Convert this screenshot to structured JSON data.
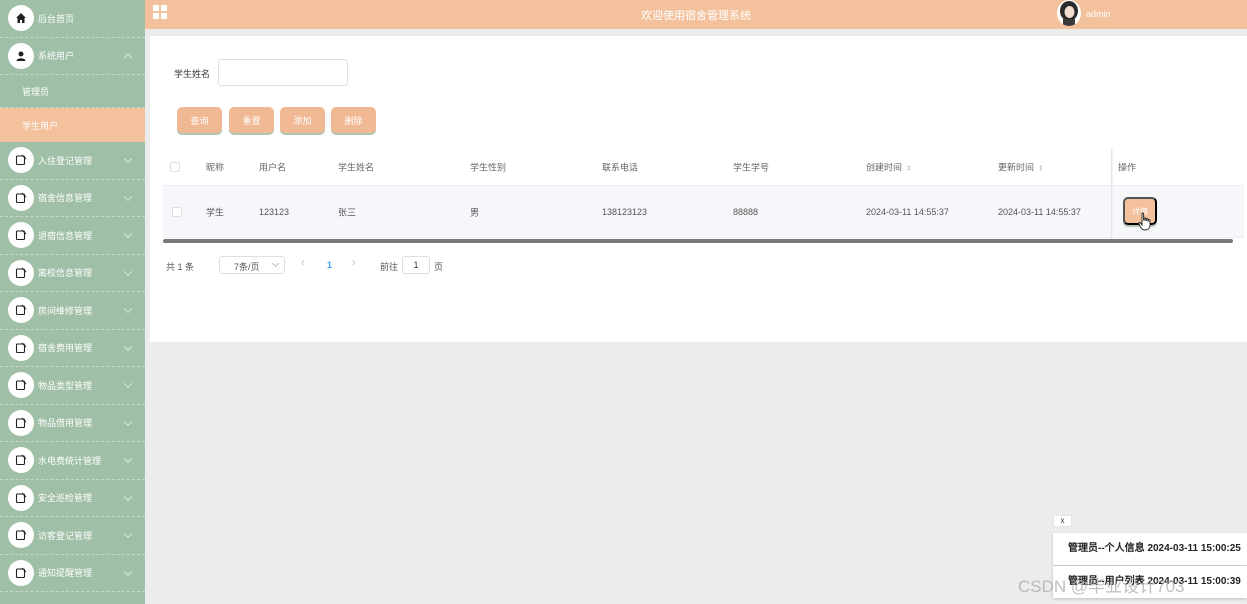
{
  "header": {
    "title": "欢迎使用宿舍管理系统",
    "user": "admin"
  },
  "sidebar": {
    "items": [
      {
        "label": "后台首页"
      },
      {
        "label": "系统用户"
      },
      {
        "label": "入住登记管理"
      },
      {
        "label": "宿舍信息管理"
      },
      {
        "label": "退宿信息管理"
      },
      {
        "label": "离校信息管理"
      },
      {
        "label": "房间维修管理"
      },
      {
        "label": "宿舍费用管理"
      },
      {
        "label": "物品类型管理"
      },
      {
        "label": "物品借用管理"
      },
      {
        "label": "水电费统计管理"
      },
      {
        "label": "安全巡检管理"
      },
      {
        "label": "访客登记管理"
      },
      {
        "label": "通知提醒管理"
      }
    ],
    "sub_items": [
      {
        "label": "管理员"
      },
      {
        "label": "学生用户"
      }
    ]
  },
  "search": {
    "label": "学生姓名",
    "value": ""
  },
  "toolbar": {
    "query": "查询",
    "reset": "重置",
    "add": "添加",
    "delete": "删除"
  },
  "table": {
    "headers": {
      "nickname": "昵称",
      "username": "用户名",
      "name": "学生姓名",
      "gender": "学生性别",
      "phone": "联系电话",
      "student_no": "学生学号",
      "created": "创建时间",
      "updated": "更新时间",
      "action": "操作"
    },
    "rows": [
      {
        "nickname": "学生",
        "username": "123123",
        "name": "张三",
        "gender": "男",
        "phone": "138123123",
        "student_no": "88888",
        "created": "2024-03-11 14:55:37",
        "updated": "2024-03-11 14:55:37",
        "action": "详情"
      }
    ]
  },
  "pager": {
    "total": "共 1 条",
    "page_size": "7条/页",
    "prev": "‹",
    "current": "1",
    "next": "›",
    "goto": "前往",
    "goto_value": "1",
    "page_unit": "页"
  },
  "notifications": {
    "close": "x",
    "items": [
      {
        "text": "管理员--个人信息 2024-03-11 15:00:25"
      },
      {
        "text": "管理员--用户列表 2024-03-11 15:00:39"
      }
    ]
  },
  "watermark": "CSDN @毕业设计703",
  "colors": {
    "header_bg": "#f3c29c",
    "sidebar_bg": "#9fbfa7",
    "button_bg": "#f0b993",
    "page_link": "#409eff"
  }
}
